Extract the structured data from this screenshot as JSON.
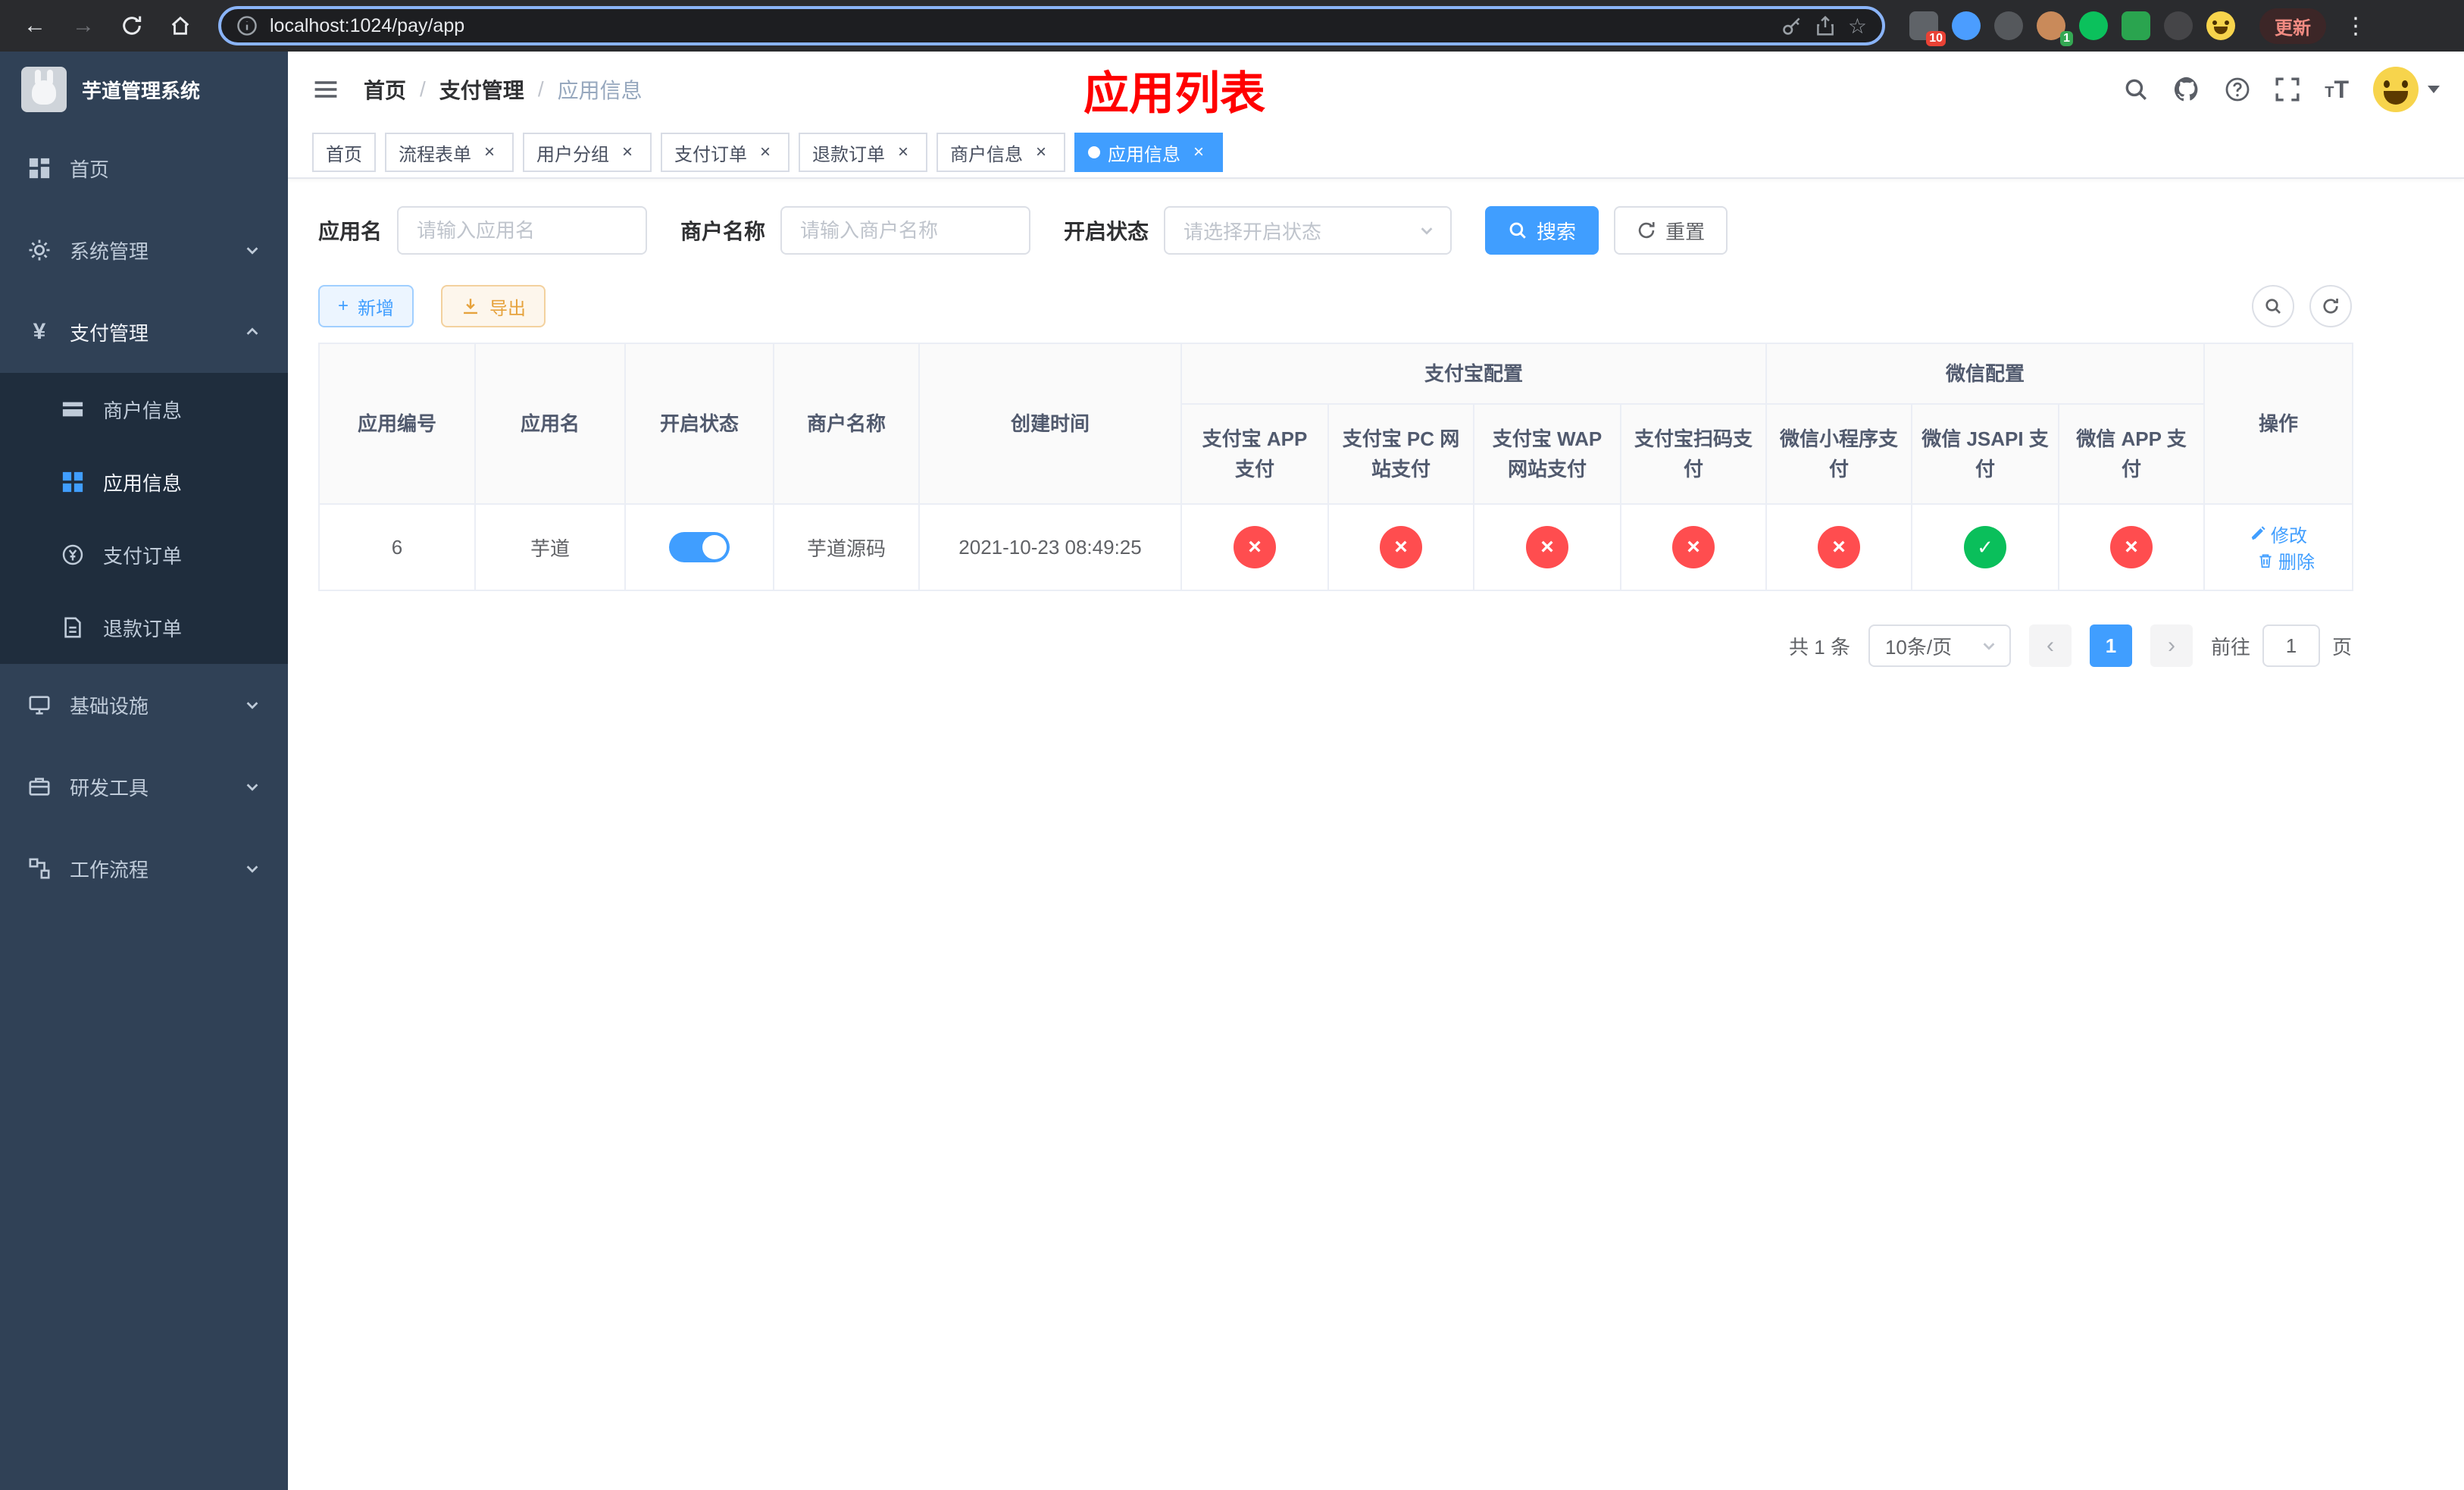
{
  "colors": {
    "primary": "#409eff",
    "danger_circle": "#ff4d4f",
    "success_circle": "#0abf5b",
    "page_title_red": "#ff0000",
    "sidebar_bg": "#304156",
    "submenu_bg": "#1f2d3d"
  },
  "icons": {
    "close": "×",
    "prev": "‹",
    "next": "›",
    "back": "←",
    "forward": "→",
    "star": "☆",
    "kebab": "⋮",
    "plus": "+",
    "slash": "/",
    "yen": "¥",
    "t_small": "T",
    "t_big": "T"
  },
  "browser": {
    "url": "localhost:1024/pay/app",
    "update_label": "更新",
    "extension_badge": "10",
    "avatar_badge": "1"
  },
  "sidebar": {
    "title": "芋道管理系统",
    "items": [
      {
        "label": "首页"
      },
      {
        "label": "系统管理"
      },
      {
        "label": "支付管理",
        "children": [
          {
            "label": "商户信息"
          },
          {
            "label": "应用信息"
          },
          {
            "label": "支付订单"
          },
          {
            "label": "退款订单"
          }
        ]
      },
      {
        "label": "基础设施"
      },
      {
        "label": "研发工具"
      },
      {
        "label": "工作流程"
      }
    ]
  },
  "header": {
    "breadcrumb": [
      "首页",
      "支付管理",
      "应用信息"
    ],
    "page_title": "应用列表"
  },
  "tabs": [
    {
      "label": "首页",
      "active": false,
      "closable": false
    },
    {
      "label": "流程表单",
      "active": false,
      "closable": true
    },
    {
      "label": "用户分组",
      "active": false,
      "closable": true
    },
    {
      "label": "支付订单",
      "active": false,
      "closable": true
    },
    {
      "label": "退款订单",
      "active": false,
      "closable": true
    },
    {
      "label": "商户信息",
      "active": false,
      "closable": true
    },
    {
      "label": "应用信息",
      "active": true,
      "closable": true
    }
  ],
  "filters": {
    "app_name_label": "应用名",
    "app_name_placeholder": "请输入应用名",
    "merchant_label": "商户名称",
    "merchant_placeholder": "请输入商户名称",
    "status_label": "开启状态",
    "status_placeholder": "请选择开启状态",
    "search_label": "搜索",
    "reset_label": "重置"
  },
  "toolbar": {
    "add_label": "新增",
    "export_label": "导出"
  },
  "table": {
    "group_alipay": "支付宝配置",
    "group_wechat": "微信配置",
    "col_app_id": "应用编号",
    "col_app_name": "应用名",
    "col_status": "开启状态",
    "col_merchant": "商户名称",
    "col_create_time": "创建时间",
    "col_alipay_app": "支付宝 APP 支付",
    "col_alipay_pc": "支付宝 PC 网站支付",
    "col_alipay_wap": "支付宝 WAP 网站支付",
    "col_alipay_qr": "支付宝扫码支付",
    "col_wx_mini": "微信小程序支付",
    "col_wx_jsapi": "微信 JSAPI 支付",
    "col_wx_app": "微信 APP 支付",
    "col_actions": "操作",
    "rows": [
      {
        "id": "6",
        "app_name": "芋道",
        "status": "on",
        "merchant": "芋道源码",
        "create_time": "2021-10-23 08:49:25",
        "configs": [
          "no",
          "no",
          "no",
          "no",
          "no",
          "yes",
          "no"
        ],
        "edit_label": "修改",
        "delete_label": "删除"
      }
    ]
  },
  "pagination": {
    "total": "共 1 条",
    "page_size": "10条/页",
    "page": "1",
    "goto_label": "前往",
    "goto_value": "1",
    "unit_label": "页"
  }
}
